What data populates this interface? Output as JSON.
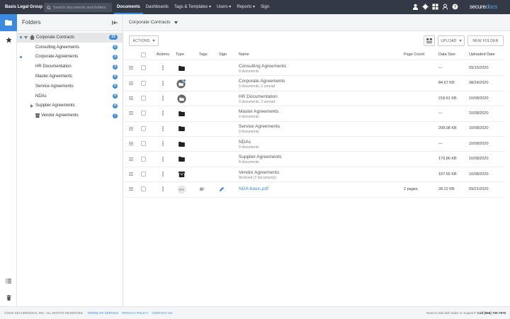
{
  "topbar": {
    "org": "Basis Legal Group",
    "search_placeholder": "Search documents and folders",
    "nav": [
      "Documents",
      "Dashboards",
      "Tags & Templates ▾",
      "Users ▾",
      "Reports ▾",
      "Sign"
    ],
    "brand_part1": "secure",
    "brand_part2": "docs"
  },
  "panel": {
    "title": "Folders",
    "tree": [
      {
        "label": "Corporate Contracts",
        "count": "23"
      },
      {
        "label": "Consulting Agreements",
        "count": "0"
      },
      {
        "label": "Corporate Agreements",
        "count": "3"
      },
      {
        "label": "HR Documentation",
        "count": "3"
      },
      {
        "label": "Master Agreements",
        "count": "0"
      },
      {
        "label": "Service Agreements",
        "count": "0"
      },
      {
        "label": "NDAs",
        "count": "0"
      },
      {
        "label": "Supplier Agreements",
        "count": "4"
      },
      {
        "label": "Vendor Agreements",
        "count": "7"
      }
    ]
  },
  "content": {
    "breadcrumb": "Corporate Contracts",
    "actions_label": "ACTIONS",
    "upload_label": "UPLOAD",
    "new_folder_label": "NEW FOLDER",
    "columns": [
      "Actions",
      "Type",
      "Tags",
      "Sign",
      "Name",
      "Page Count",
      "Data Size",
      "Uploaded Date"
    ],
    "rows": [
      {
        "name": "Consulting Agreements",
        "sub": "0 documents",
        "pages": "",
        "size": "—",
        "date": "09/15/2020",
        "type": "folder"
      },
      {
        "name": "Corporate Agreements",
        "sub": "3 documents, 3 unread",
        "pages": "",
        "size": "84.67 KB",
        "date": "08/24/2020",
        "type": "folder-shared-unread"
      },
      {
        "name": "HR Documentation",
        "sub": "3 documents, 3 unread",
        "pages": "",
        "size": "218.61 KB",
        "date": "10/08/2020",
        "type": "folder-shared"
      },
      {
        "name": "Master Agreements",
        "sub": "0 documents",
        "pages": "",
        "size": "—",
        "date": "10/08/2020",
        "type": "folder"
      },
      {
        "name": "Service Agreements",
        "sub": "0 documents",
        "pages": "",
        "size": "208.08 KB",
        "date": "10/08/2020",
        "type": "folder"
      },
      {
        "name": "NDAs",
        "sub": "0 documents",
        "pages": "",
        "size": "—",
        "date": "10/08/2020",
        "type": "folder"
      },
      {
        "name": "Supplier Agreements",
        "sub": "4 documents",
        "pages": "",
        "size": "179.86 KB",
        "date": "10/08/2020",
        "type": "folder"
      },
      {
        "name": "Vendor Agreements",
        "sub": "Archived (7 documents)",
        "pages": "",
        "size": "197.55 KB",
        "date": "10/08/2020",
        "type": "archive"
      },
      {
        "name": "NDA-basic.pdf",
        "sub": "",
        "pages": "2 pages",
        "size": "28.22 KB",
        "date": "09/21/2020",
        "type": "pdf"
      }
    ]
  },
  "footer": {
    "copyright": "©2020 SECUREDOCS, INC. ALL RIGHTS RESERVED.",
    "links": [
      "TERMS OF SERVICE",
      "PRIVACY POLICY",
      "CONTACT US"
    ],
    "sales_text": "Need to talk with Sales or Support?",
    "phone": "Call (866) 700-7975"
  },
  "colors": {
    "accent": "#3a8be0",
    "topbar": "#333a45"
  }
}
